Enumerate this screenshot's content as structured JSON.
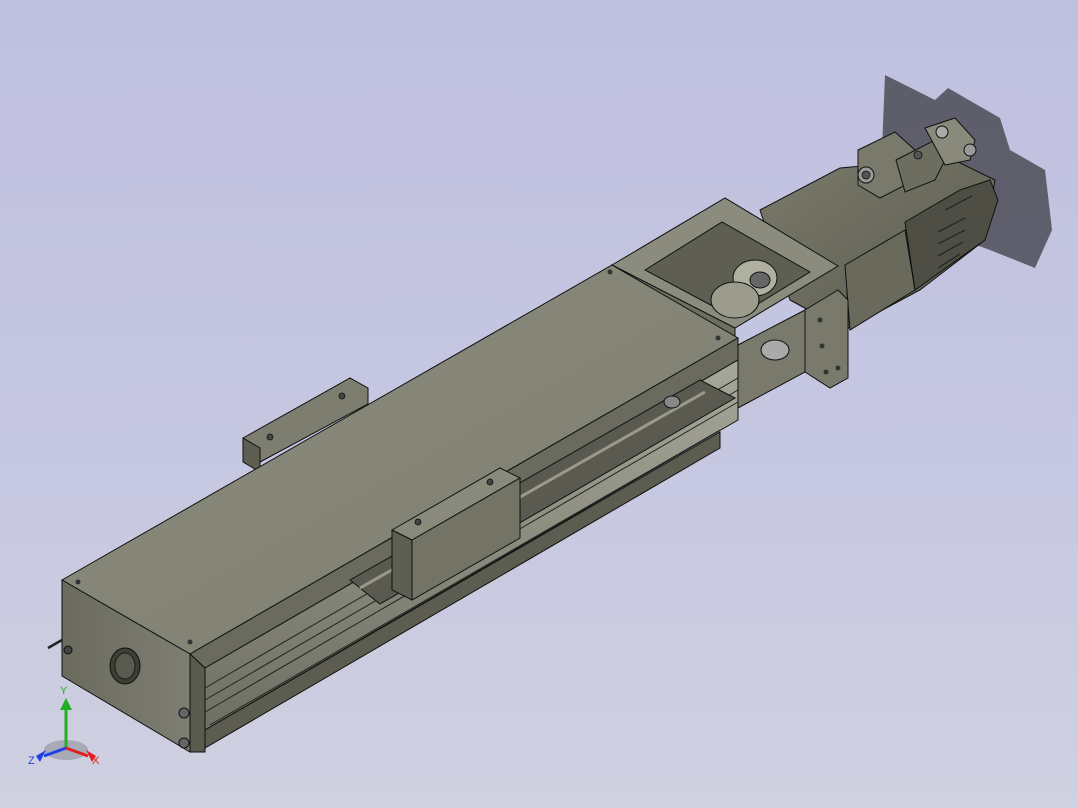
{
  "viewport": {
    "background_top": "#c0c0e0",
    "background_bottom": "#cfd0e0"
  },
  "model": {
    "description_icon": "linear-actuator-assembly",
    "body_color": "#8a8a7c",
    "edge_color": "#111111"
  },
  "triad": {
    "x_label": "X",
    "y_label": "Y",
    "z_label": "Z",
    "x_color": "#e02020",
    "y_color": "#20b020",
    "z_color": "#2040e0"
  }
}
